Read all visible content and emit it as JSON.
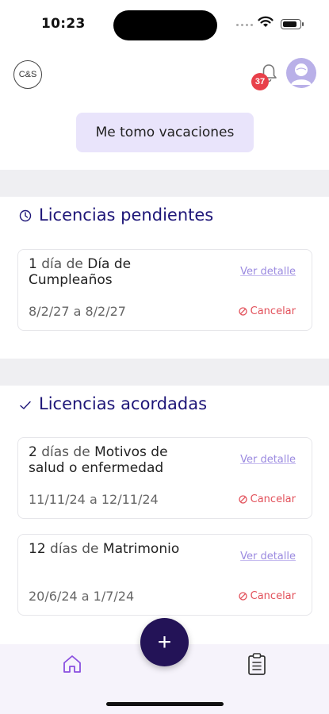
{
  "status_bar": {
    "time": "10:23",
    "battery_level": 0.85
  },
  "app_bar": {
    "logo_text": "C&S",
    "notifications_count": "37"
  },
  "hero": {
    "vacation_button_label": "Me tomo vacaciones"
  },
  "pending": {
    "title": "Licencias pendientes",
    "items": [
      {
        "qty": "1",
        "unit": "día de",
        "type": "Día de Cumpleaños",
        "dates": "8/2/27 a 8/2/27",
        "detail_label": "Ver detalle",
        "cancel_label": "Cancelar"
      }
    ]
  },
  "agreed": {
    "title": "Licencias acordadas",
    "items": [
      {
        "qty": "2",
        "unit": "días de",
        "type": "Motivos de salud o enfermedad",
        "dates": "11/11/24 a 12/11/24",
        "detail_label": "Ver detalle",
        "cancel_label": "Cancelar"
      },
      {
        "qty": "12",
        "unit": "días de",
        "type": "Matrimonio",
        "dates": "20/6/24 a 1/7/24",
        "detail_label": "Ver detalle",
        "cancel_label": "Cancelar"
      }
    ]
  },
  "bottom_nav": {
    "fab_label": "+"
  },
  "colors": {
    "accent": "#231357",
    "title": "#1e1678",
    "link": "#9b8ae0",
    "danger": "#e2505a",
    "badge": "#e8404a",
    "button_bg": "#e9e4fb"
  }
}
